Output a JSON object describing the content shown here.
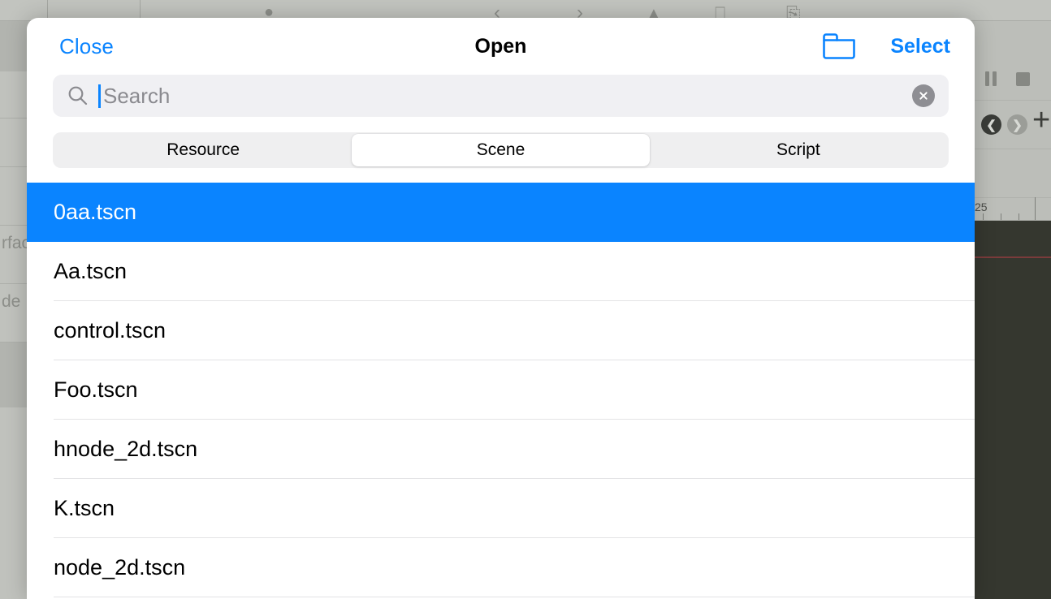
{
  "background": {
    "app": "godot-editor",
    "topbar_icons": [
      "chevron-left-icon",
      "chevron-right-icon",
      "triangle-up-icon",
      "window-icon",
      "panel-icon"
    ],
    "left_panel_rows": [
      {
        "label": "",
        "selected": true
      },
      {
        "label": "",
        "selected": false
      },
      {
        "label": "",
        "selected": false
      },
      {
        "label": "",
        "selected": false
      },
      {
        "label": "rfac",
        "selected": false
      },
      {
        "label": "de",
        "selected": false
      },
      {
        "label": "",
        "selected": true
      }
    ],
    "right_toolbar": {
      "pause_icon": "pause-icon",
      "stop_icon": "stop-icon",
      "back_icon": "circle-back-icon",
      "forward_icon": "circle-forward-icon",
      "add_icon": "plus-icon"
    },
    "ruler": {
      "label": "25"
    }
  },
  "sheet": {
    "navbar": {
      "close_label": "Close",
      "title": "Open",
      "folder_icon": "folder-icon",
      "select_label": "Select"
    },
    "search": {
      "icon": "search-icon",
      "placeholder": "Search",
      "value": "",
      "clear_icon": "clear-circle-icon"
    },
    "segmented": {
      "options": [
        {
          "label": "Resource",
          "active": false
        },
        {
          "label": "Scene",
          "active": true
        },
        {
          "label": "Script",
          "active": false
        }
      ]
    },
    "files": [
      {
        "name": "0aa.tscn",
        "selected": true
      },
      {
        "name": "Aa.tscn",
        "selected": false
      },
      {
        "name": "control.tscn",
        "selected": false
      },
      {
        "name": "Foo.tscn",
        "selected": false
      },
      {
        "name": "hnode_2d.tscn",
        "selected": false
      },
      {
        "name": "K.tscn",
        "selected": false
      },
      {
        "name": "node_2d.tscn",
        "selected": false
      }
    ]
  },
  "colors": {
    "accent": "#0a84ff",
    "selection": "#0a84ff",
    "sheet_bg": "#ffffff",
    "field_bg": "#f0f0f3",
    "backdrop": "#b9bbb6",
    "viewport": "#35372f"
  }
}
